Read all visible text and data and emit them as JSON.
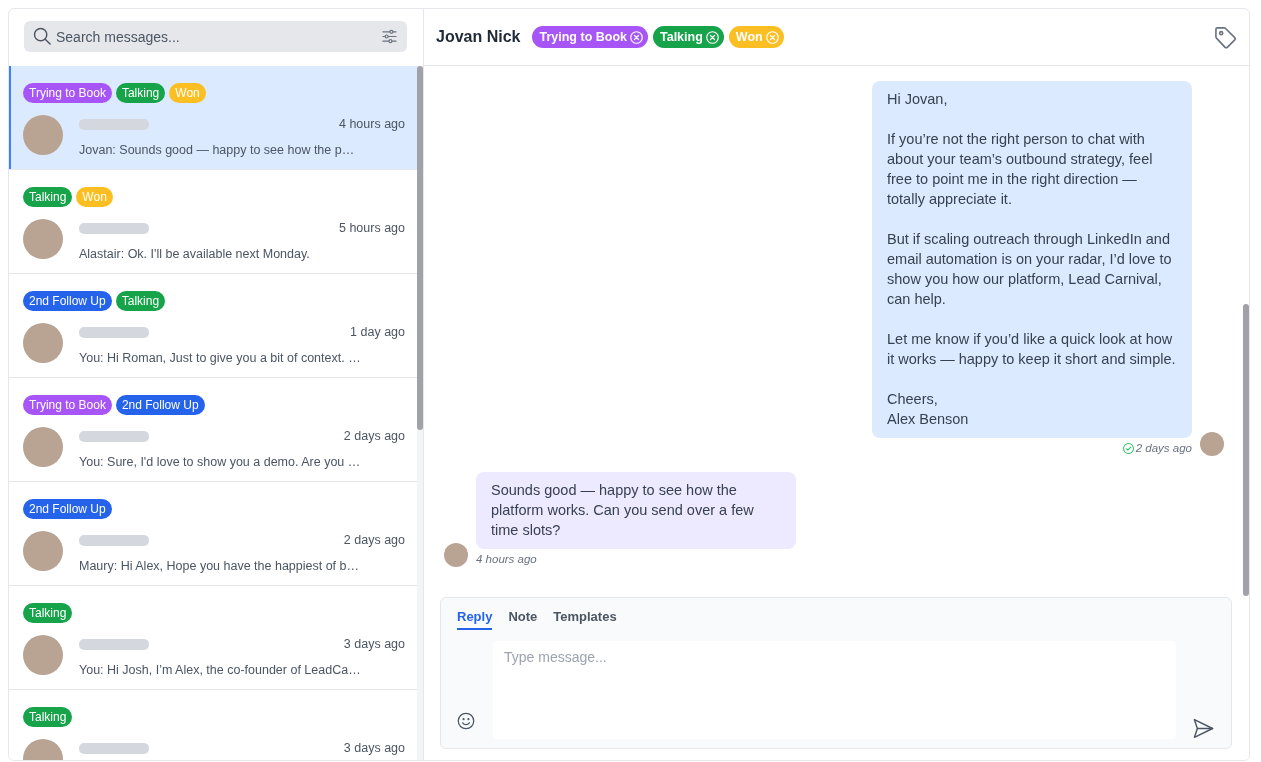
{
  "search": {
    "placeholder": "Search messages..."
  },
  "conversations": [
    {
      "selected": true,
      "tags": [
        {
          "label": "Trying to Book",
          "color": "#a855f7"
        },
        {
          "label": "Talking",
          "color": "#16a34a"
        },
        {
          "label": "Won",
          "color": "#fbbf24"
        }
      ],
      "time": "4 hours ago",
      "preview": "Jovan: Sounds good — happy to see how the p…"
    },
    {
      "selected": false,
      "tags": [
        {
          "label": "Talking",
          "color": "#16a34a"
        },
        {
          "label": "Won",
          "color": "#fbbf24"
        }
      ],
      "time": "5 hours ago",
      "preview": "Alastair: Ok. I'll be available next Monday."
    },
    {
      "selected": false,
      "tags": [
        {
          "label": "2nd Follow Up",
          "color": "#2563eb"
        },
        {
          "label": "Talking",
          "color": "#16a34a"
        }
      ],
      "time": "1 day ago",
      "preview": "You: Hi Roman, Just to give you a bit of context. …"
    },
    {
      "selected": false,
      "tags": [
        {
          "label": "Trying to Book",
          "color": "#a855f7"
        },
        {
          "label": "2nd Follow Up",
          "color": "#2563eb"
        }
      ],
      "time": "2 days ago",
      "preview": "You: Sure, I'd love to show you a demo. Are you …"
    },
    {
      "selected": false,
      "tags": [
        {
          "label": "2nd Follow Up",
          "color": "#2563eb"
        }
      ],
      "time": "2 days ago",
      "preview": "Maury: Hi Alex, Hope you have the happiest of b…"
    },
    {
      "selected": false,
      "tags": [
        {
          "label": "Talking",
          "color": "#16a34a"
        }
      ],
      "time": "3 days ago",
      "preview": "You: Hi Josh, I’m Alex, the co-founder of LeadCa…"
    },
    {
      "selected": false,
      "tags": [
        {
          "label": "Talking",
          "color": "#16a34a"
        }
      ],
      "time": "3 days ago"
    }
  ],
  "chat": {
    "contact": "Jovan Nick",
    "tags": [
      {
        "label": "Trying to Book",
        "color": "#a855f7"
      },
      {
        "label": "Talking",
        "color": "#16a34a"
      },
      {
        "label": "Won",
        "color": "#fbbf24"
      }
    ],
    "messages": [
      {
        "kind": "outgoing",
        "text": "Hi Jovan,\n\nIf you’re not the right person to chat with about your team’s outbound strategy, feel free to point me in the right direction — totally appreciate it.\n\nBut if scaling outreach through LinkedIn and email automation is on your radar, I’d love to show you how our platform, Lead Carnival, can help.\n\nLet me know if you’d like a quick look at how it works — happy to keep it short and simple.\n\nCheers,\nAlex Benson",
        "time": "2 days ago",
        "delivered": true
      },
      {
        "kind": "incoming",
        "text": "Sounds good — happy to see how the platform works. Can you send over a few time slots?",
        "time": "4 hours ago",
        "delivered": false
      }
    ]
  },
  "composer": {
    "tabs": [
      {
        "label": "Reply",
        "selected": true
      },
      {
        "label": "Note",
        "selected": false
      },
      {
        "label": "Templates",
        "selected": false
      }
    ],
    "placeholder": "Type message..."
  }
}
